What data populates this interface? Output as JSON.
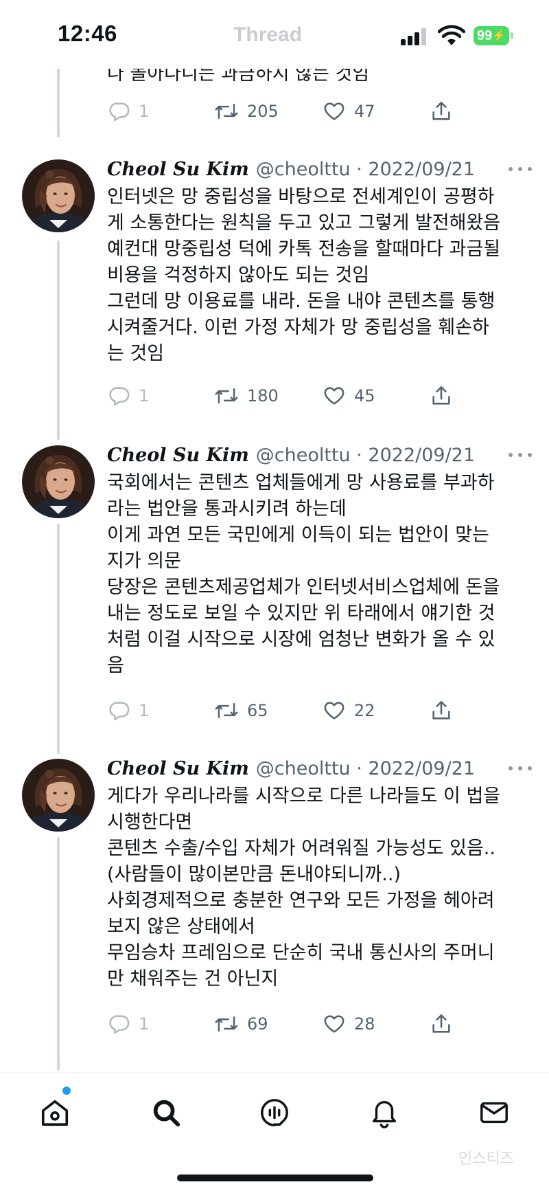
{
  "status_bar": {
    "time": "12:46",
    "ghost_title": "Thread",
    "battery": "99"
  },
  "partial_tweet": {
    "text": "나 놀아다니는 과금하지 않는 것임",
    "replies": "1",
    "retweets": "205",
    "likes": "47"
  },
  "tweets": [
    {
      "author": "Cheol Su Kim",
      "meta": "@cheolttu · 2022/09/21",
      "text": "인터넷은 망 중립성을 바탕으로 전세계인이 공평하\n게 소통한다는 원칙을 두고 있고 그렇게 발전해왔음\n예컨대 망중립성 덕에 카톡 전송을 할때마다 과금될\n비용을 걱정하지 않아도 되는 것임\n그런데 망 이용료를 내라. 돈을 내야 콘텐츠를 통행\n시켜줄거다. 이런 가정 자체가 망 중립성을 훼손하\n는 것임",
      "replies": "1",
      "retweets": "180",
      "likes": "45"
    },
    {
      "author": "Cheol Su Kim",
      "meta": "@cheolttu · 2022/09/21",
      "text": "국회에서는 콘텐츠 업체들에게 망 사용료를 부과하\n라는 법안을 통과시키려 하는데\n이게 과연 모든 국민에게 이득이 되는 법안이 맞는\n지가 의문\n당장은 콘텐츠제공업체가 인터넷서비스업체에 돈을\n내는 정도로 보일 수 있지만 위 타래에서 얘기한 것\n처럼 이걸 시작으로 시장에 엄청난 변화가 올 수 있\n음",
      "replies": "1",
      "retweets": "65",
      "likes": "22"
    },
    {
      "author": "Cheol Su Kim",
      "meta": "@cheolttu · 2022/09/21",
      "text": "게다가 우리나라를 시작으로 다른 나라들도 이 법을\n시행한다면\n콘텐츠 수출/수입 자체가 어려워질 가능성도 있음..\n(사람들이 많이본만큼 돈내야되니까..)\n사회경제적으로 충분한 연구와 모든 가정을 헤아려\n보지 않은 상태에서\n무임승차 프레임으로 단순히 국내 통신사의 주머니\n만 채워주는 건 아닌지",
      "replies": "1",
      "retweets": "69",
      "likes": "28"
    }
  ],
  "tab_bar": {
    "items": [
      "home-icon",
      "search-icon",
      "spaces-icon",
      "notifications-icon",
      "messages-icon"
    ],
    "watermark": "인스티즈"
  },
  "colors": {
    "text": "#0f1419",
    "secondary": "#536471",
    "thread_line": "#cfd9de",
    "battery": "#4cd964",
    "notification_dot": "#1d9bf0"
  }
}
